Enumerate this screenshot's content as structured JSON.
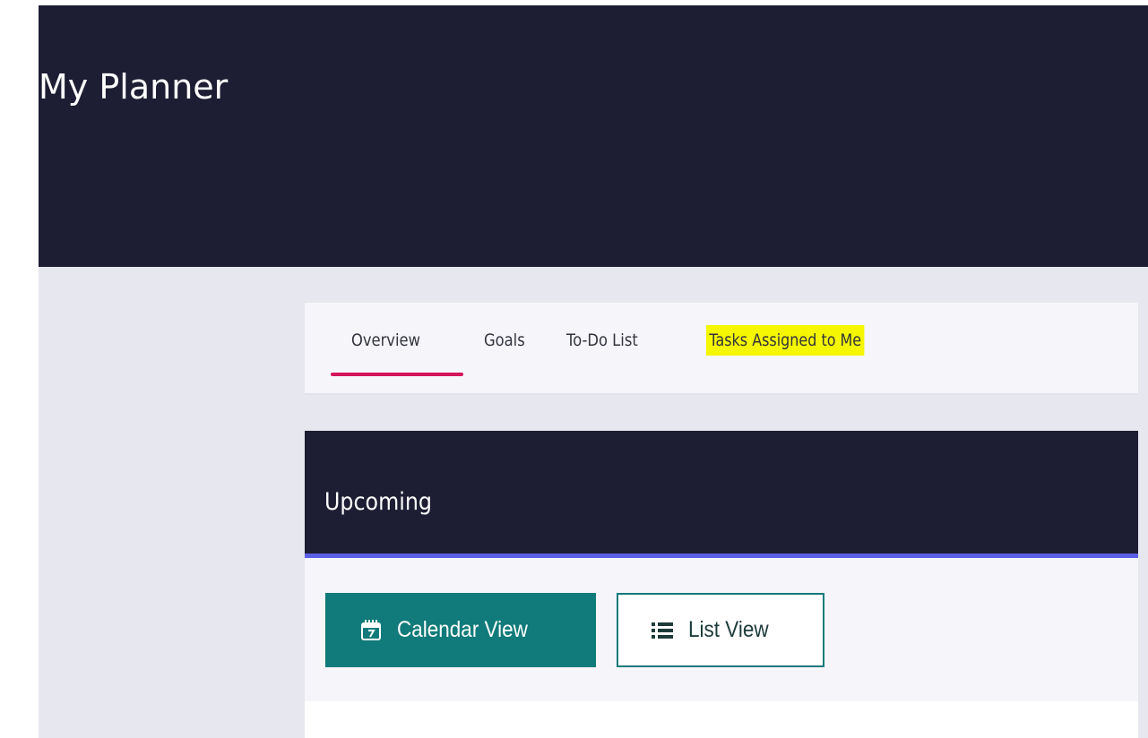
{
  "header": {
    "title": "My Planner"
  },
  "tabs": [
    {
      "label": "Overview",
      "active": true
    },
    {
      "label": "Goals",
      "active": false
    },
    {
      "label": "To-Do List",
      "active": false
    },
    {
      "label": "Tasks Assigned to Me",
      "active": false,
      "highlighted": true
    }
  ],
  "panel": {
    "title": "Upcoming",
    "buttons": {
      "calendar": {
        "label": "Calendar View",
        "icon": "calendar-icon",
        "selected": true
      },
      "list": {
        "label": "List View",
        "icon": "list-icon",
        "selected": false
      }
    }
  },
  "colors": {
    "header_bg": "#1d1d33",
    "page_bg": "#e7e7ef",
    "tab_underline": "#d4145a",
    "highlight": "#f4f700",
    "panel_accent": "#5b5fe6",
    "teal": "#117a7a"
  }
}
